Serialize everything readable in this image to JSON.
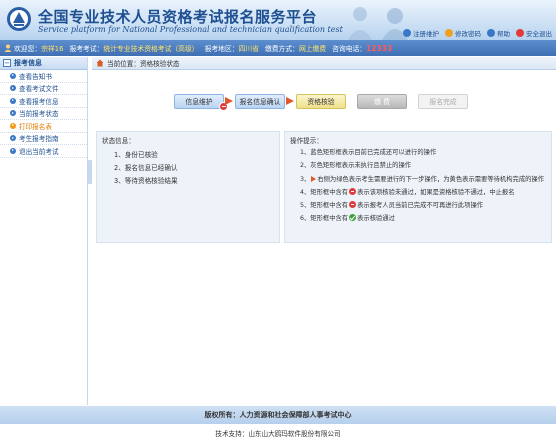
{
  "header": {
    "title_cn": "全国专业技术人员资格考试报名服务平台",
    "title_en": "Service platform for National Professional and technician qualification test",
    "links": [
      {
        "label": "注册维护",
        "icon": "register-icon",
        "color": "#3a78c6"
      },
      {
        "label": "修改密码",
        "icon": "lock-icon",
        "color": "#f0a020"
      },
      {
        "label": "帮助",
        "icon": "help-icon",
        "color": "#3a78c6"
      },
      {
        "label": "安全退出",
        "icon": "exit-icon",
        "color": "#e23a3a"
      }
    ]
  },
  "infobar": {
    "welcome_label": "欢迎您：",
    "welcome_value": "宗祥16",
    "exam_label": "报考考试：",
    "exam_value": "统计专业技术资格考试（高级）",
    "region_label": "报考地区：",
    "region_value": "四川省",
    "fee_label": "缴费方式：",
    "fee_value": "网上缴费",
    "hotline_label": "咨询电话：",
    "hotline_value": "12333"
  },
  "sidebar": {
    "header": "报考信息",
    "toggle": "−",
    "items": [
      {
        "label": "查看告知书"
      },
      {
        "label": "查看考试文件"
      },
      {
        "label": "查看报考信息"
      },
      {
        "label": "当前报考状态"
      },
      {
        "label": "打印报名表"
      },
      {
        "label": "考生报考指南"
      },
      {
        "label": "退出当前考试"
      }
    ],
    "active_index": 4
  },
  "breadcrumb": "当前位置：资格核验状态",
  "steps": [
    {
      "label": "信息维护",
      "style": "blue"
    },
    {
      "label": "报名信息确认",
      "style": "blue"
    },
    {
      "label": "资格核验",
      "style": "yellow"
    },
    {
      "label": "缴 费",
      "style": "gray"
    },
    {
      "label": "报名完成",
      "style": "light"
    }
  ],
  "status_panel": {
    "title": "状态信息：",
    "lines": [
      "1、身份已核验",
      "2、报名信息已经确认",
      "3、等待资格核验结果"
    ]
  },
  "tips_panel": {
    "title": "操作提示：",
    "lines": [
      {
        "pre": "1、蓝色矩形框表示目前已完成还可以进行的操作",
        "mark": "",
        "post": ""
      },
      {
        "pre": "2、灰色矩形框表示未执行且禁止的操作",
        "mark": "",
        "post": ""
      },
      {
        "pre": "3、",
        "mark": "arrow",
        "post": "右侧为绿色表示考生需要进行的下一步操作，为黄色表示需要等待机构完成的操作"
      },
      {
        "pre": "4、矩形框中含有",
        "mark": "red",
        "post": "表示该项核验未通过，如果是资格核验不通过，中止报名"
      },
      {
        "pre": "5、矩形框中含有",
        "mark": "red",
        "post": "表示报考人员当前已完成不可再进行此项操作"
      },
      {
        "pre": "6、矩形框中含有",
        "mark": "green",
        "post": "表示核验通过"
      }
    ]
  },
  "footer": {
    "copyright": "版权所有：人力资源和社会保障部人事考试中心",
    "support": "技术支持：山东山大鸥玛软件股份有限公司"
  }
}
